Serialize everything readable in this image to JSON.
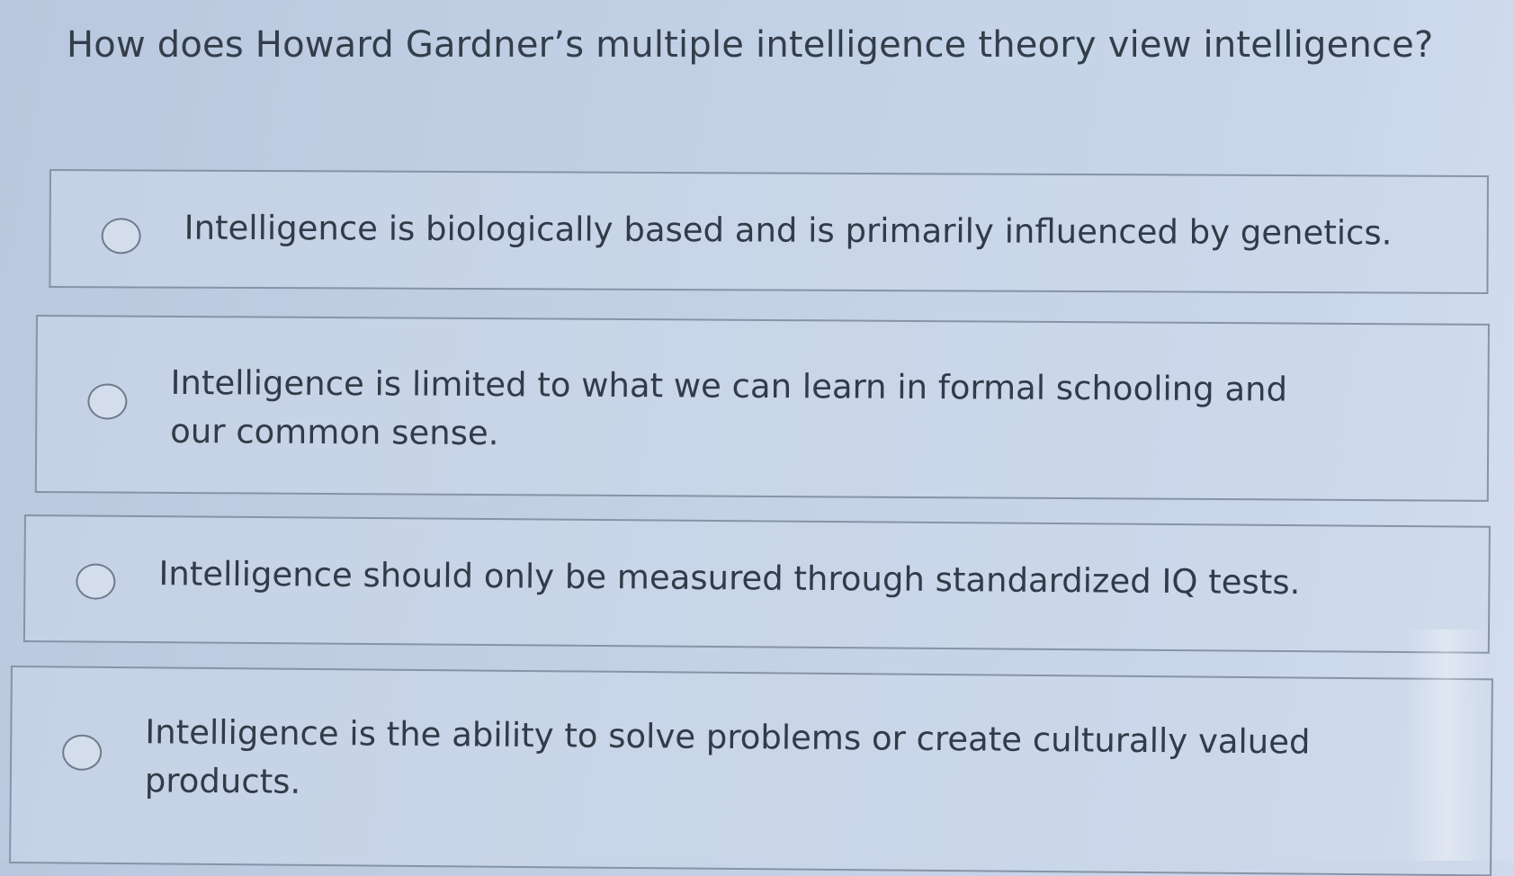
{
  "question": {
    "text": "How does Howard Gardner’s multiple intelligence theory view intelligence?"
  },
  "options": [
    {
      "label": "Intelligence is biologically based and is primarily influenced by genetics.",
      "selected": false
    },
    {
      "label": "Intelligence is limited to what we can learn in formal schooling and our common sense.",
      "selected": false
    },
    {
      "label": "Intelligence should only be measured through standardized IQ tests.",
      "selected": false
    },
    {
      "label": "Intelligence is the ability to solve problems or create culturally valued products.",
      "selected": false
    }
  ],
  "colors": {
    "background": "#c3d1e6",
    "text": "#323b48",
    "border": "#8793a6",
    "radio_border": "#6f7b8d"
  }
}
